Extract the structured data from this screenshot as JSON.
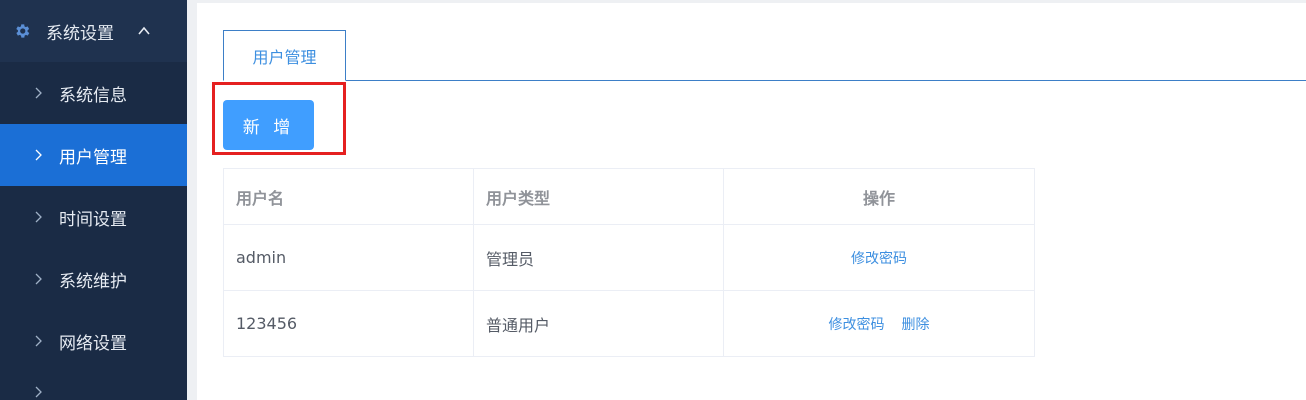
{
  "sidebar": {
    "header_label": "系统设置",
    "header_icon": "gear-icon",
    "items": [
      {
        "label": "系统信息",
        "active": false
      },
      {
        "label": "用户管理",
        "active": true
      },
      {
        "label": "时间设置",
        "active": false
      },
      {
        "label": "系统维护",
        "active": false
      },
      {
        "label": "网络设置",
        "active": false
      }
    ]
  },
  "tabs": [
    {
      "label": "用户管理",
      "active": true
    }
  ],
  "toolbar": {
    "add_label": "新 增"
  },
  "table": {
    "headers": [
      "用户名",
      "用户类型",
      "操作"
    ],
    "rows": [
      {
        "username": "admin",
        "type": "管理员",
        "actions": [
          "修改密码"
        ]
      },
      {
        "username": "123456",
        "type": "普通用户",
        "actions": [
          "修改密码",
          "删除"
        ]
      }
    ]
  },
  "colors": {
    "sidebar_bg": "#1a2b45",
    "active_item": "#1b6fd6",
    "primary": "#409eff",
    "link": "#3d8fe0",
    "highlight": "#e52020"
  }
}
